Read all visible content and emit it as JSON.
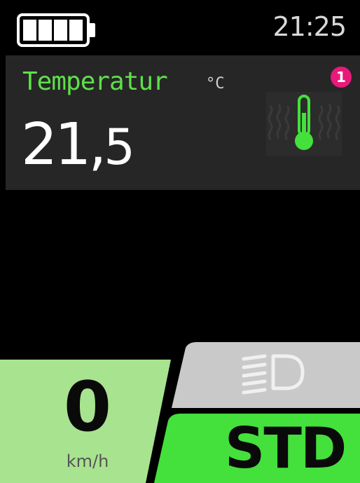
{
  "status_bar": {
    "battery_level": 1.0,
    "battery_icon": "battery-full-icon",
    "time": "21:25"
  },
  "temperature_card": {
    "title": "Temperatur",
    "unit": "°C",
    "value_int": "21",
    "value_sep": ",",
    "value_dec": "5",
    "badge": "1",
    "icon": "thermometer-icon"
  },
  "speed": {
    "value": "0",
    "unit": "km/h"
  },
  "light_button": {
    "icon": "headlight-icon"
  },
  "mode_button": {
    "label": "STD"
  },
  "colors": {
    "accent_green": "#5ee04a",
    "mode_green": "#44e03c",
    "speed_green": "#a8e38f",
    "light_grey": "#c9c9c9",
    "card_bg": "#262626",
    "badge_pink": "#e8197a"
  }
}
